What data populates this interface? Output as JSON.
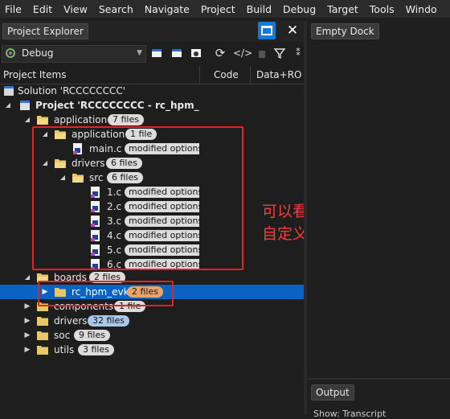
{
  "menu": [
    "File",
    "Edit",
    "View",
    "Search",
    "Navigate",
    "Project",
    "Build",
    "Debug",
    "Target",
    "Tools",
    "Windo"
  ],
  "project_explorer": {
    "tab_label": "Project Explorer",
    "config": "Debug",
    "columns": {
      "items": "Project Items",
      "code": "Code",
      "data_ro": "Data+RO"
    }
  },
  "tree": {
    "solution": "Solution 'RCCCCCCCC'",
    "project": "Project 'RCCCCCCCC - rc_hpm_evk'",
    "application": {
      "label": "application",
      "badge": "7 files"
    },
    "application_sub": {
      "label": "application",
      "badge": "1 file"
    },
    "main_c": {
      "label": "main.c",
      "badge": "modified options"
    },
    "drivers_sub": {
      "label": "drivers",
      "badge": "6 files"
    },
    "src": {
      "label": "src",
      "badge": "6 files"
    },
    "files": [
      {
        "label": "1.c",
        "badge": "modified options"
      },
      {
        "label": "2.c",
        "badge": "modified options"
      },
      {
        "label": "3.c",
        "badge": "modified options"
      },
      {
        "label": "4.c",
        "badge": "modified options"
      },
      {
        "label": "5.c",
        "badge": "modified options"
      },
      {
        "label": "6.c",
        "badge": "modified options"
      }
    ],
    "boards": {
      "label": "boards",
      "badge": "2 files"
    },
    "rc_hpm_evk": {
      "label": "rc_hpm_evk",
      "badge": "2 files"
    },
    "components": {
      "label": "components",
      "badge": "1 file"
    },
    "drivers": {
      "label": "drivers",
      "badge": "32 files"
    },
    "soc": {
      "label": "soc",
      "badge": "9 files"
    },
    "utils": {
      "label": "utils",
      "badge": "3 files"
    }
  },
  "annotation": {
    "line1": "可以看到生成的就是",
    "line2": "自定义custom board和a"
  },
  "right_panel": {
    "empty_dock": "Empty Dock",
    "output": "Output",
    "bottom_text": "Show: Transcript"
  },
  "colors": {
    "selection": "#0a63c2",
    "highlight": "#e82020",
    "accent": "#1479d8"
  }
}
